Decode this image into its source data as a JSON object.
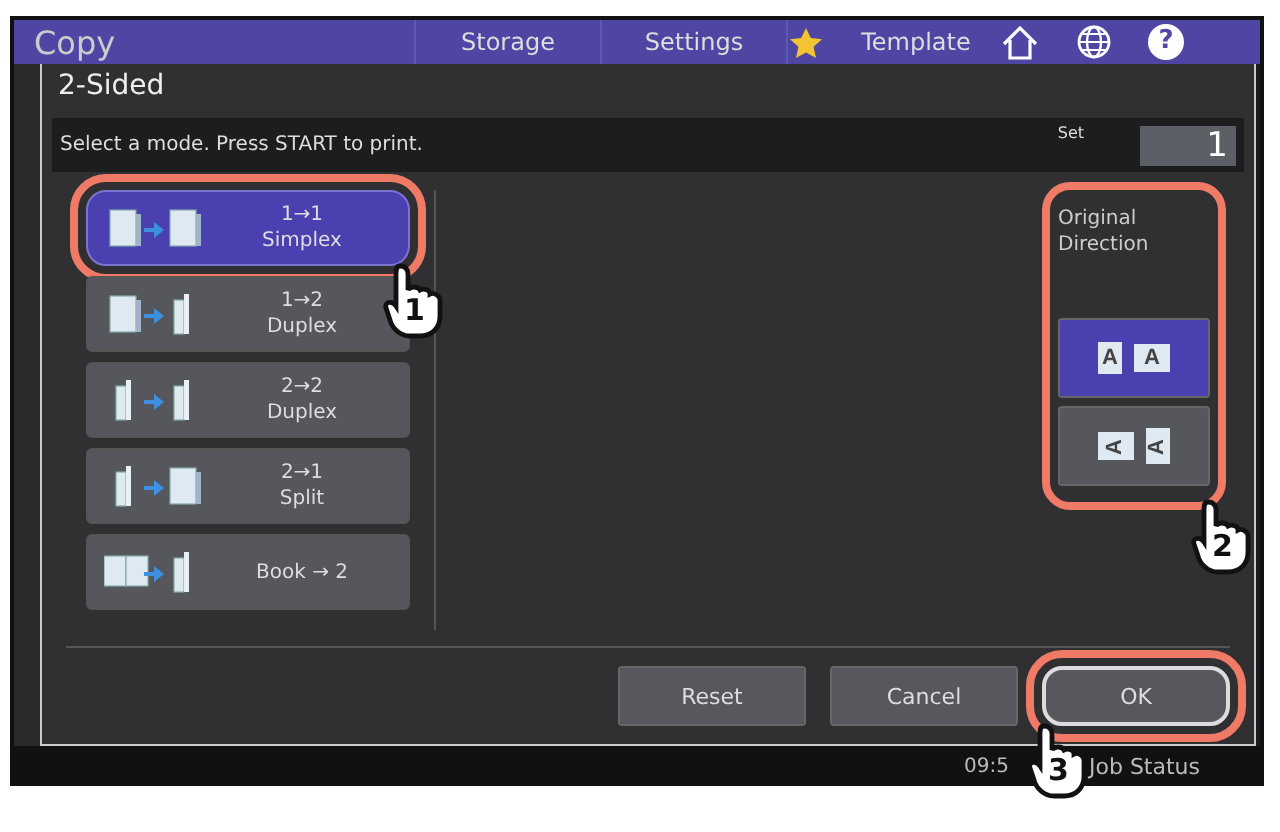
{
  "top_bar": {
    "title": "Copy",
    "help_glyph": "?",
    "tabs": [
      {
        "label": "Storage",
        "starred": false
      },
      {
        "label": "Settings",
        "starred": false
      },
      {
        "label": "Template",
        "starred": true
      }
    ]
  },
  "dialog": {
    "title": "2-Sided",
    "message": "Select a mode. Press START to print.",
    "set_label": "Set",
    "set_value": "1",
    "modes": [
      {
        "kind": "simplex",
        "line1": "1→1",
        "line2": "Simplex",
        "selected": true,
        "callout": "1"
      },
      {
        "kind": "one_to_duplex",
        "line1": "1→2",
        "line2": "Duplex",
        "selected": false
      },
      {
        "kind": "duplex",
        "line1": "2→2",
        "line2": "Duplex",
        "selected": false
      },
      {
        "kind": "split",
        "line1": "2→1",
        "line2": "Split",
        "selected": false
      },
      {
        "kind": "book",
        "line1": "Book → 2",
        "selected": false
      }
    ],
    "direction": {
      "label": "Original Direction",
      "callout": "2",
      "options": [
        {
          "kind": "upright",
          "glyphs": [
            "A",
            "A"
          ],
          "selected": true
        },
        {
          "kind": "sideways",
          "glyphs": [
            "A",
            "A"
          ],
          "selected": false
        }
      ]
    },
    "buttons": [
      {
        "kind": "reset",
        "label": "Reset"
      },
      {
        "kind": "cancel",
        "label": "Cancel"
      },
      {
        "kind": "ok",
        "label": "OK",
        "callout": "3"
      }
    ]
  },
  "status_bar": {
    "time": "09:5",
    "job_status": "Job Status"
  }
}
